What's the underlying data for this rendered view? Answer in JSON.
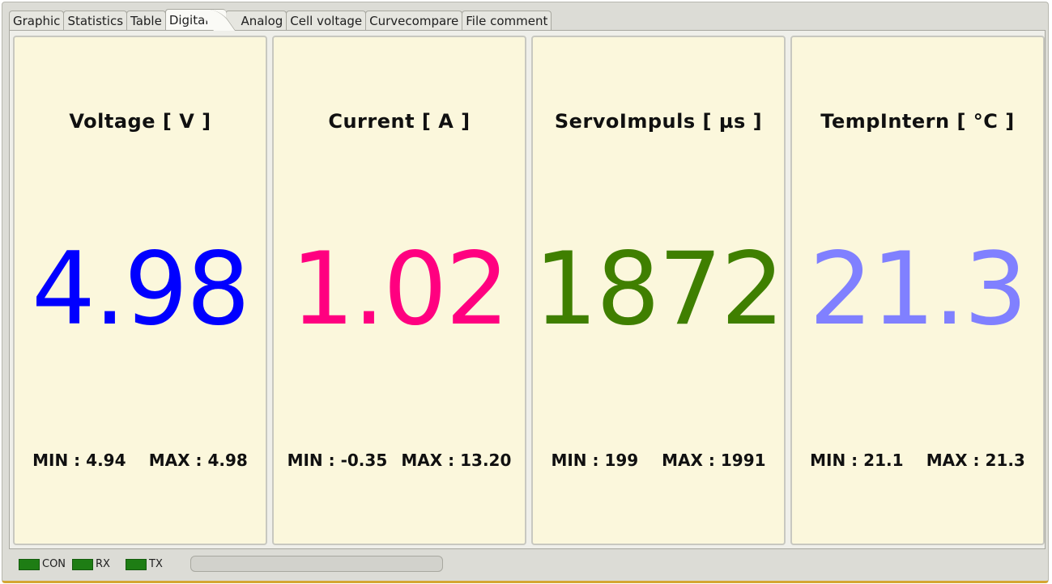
{
  "tabs": [
    {
      "label": "Graphic"
    },
    {
      "label": "Statistics"
    },
    {
      "label": "Table"
    },
    {
      "label": "Digital",
      "active": true
    },
    {
      "label": "Analog"
    },
    {
      "label": "Cell voltage"
    },
    {
      "label": "Curvecompare"
    },
    {
      "label": "File comment"
    }
  ],
  "panels": [
    {
      "title": "Voltage [ V ]",
      "value": "4.98",
      "color": "#0000ff",
      "min": "MIN : 4.94",
      "max": "MAX : 4.98"
    },
    {
      "title": "Current [ A ]",
      "value": "1.02",
      "color": "#ff0080",
      "min": "MIN : -0.35",
      "max": "MAX : 13.20"
    },
    {
      "title": "ServoImpuls [ µs ]",
      "value": "1872",
      "color": "#3f7f00",
      "min": "MIN : 199",
      "max": "MAX : 1991"
    },
    {
      "title": "TempIntern [ °C ]",
      "value": "21.3",
      "color": "#8080ff",
      "min": "MIN : 21.1",
      "max": "MAX : 21.3"
    }
  ],
  "status": {
    "con_label": "CON",
    "rx_label": "RX",
    "tx_label": "TX",
    "led_color": "#1e7d14",
    "progress": 0
  }
}
